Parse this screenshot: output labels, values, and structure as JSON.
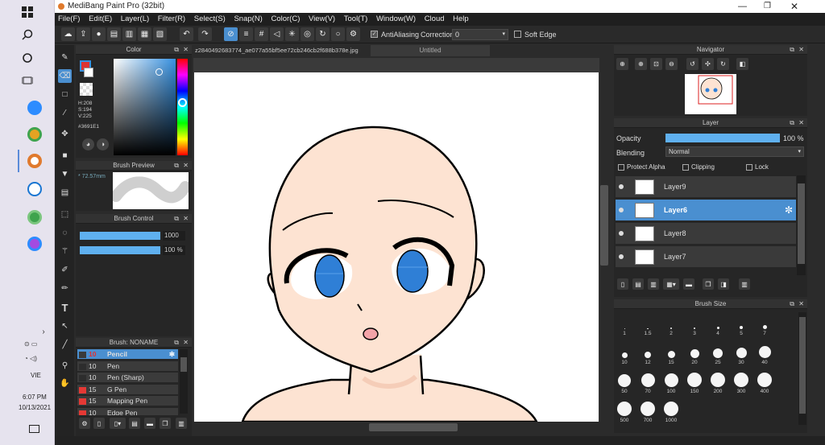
{
  "window": {
    "title": "MediBang Paint Pro (32bit)"
  },
  "menu": [
    "File(F)",
    "Edit(E)",
    "Layer(L)",
    "Filter(R)",
    "Select(S)",
    "Snap(N)",
    "Color(C)",
    "View(V)",
    "Tool(T)",
    "Window(W)",
    "Cloud",
    "Help"
  ],
  "toolbar": {
    "antialias_label": "AntiAliasing",
    "correction_label": "Correction",
    "correction_value": "0",
    "soft_edge_label": "Soft Edge"
  },
  "color_panel": {
    "title": "Color",
    "h": "H:208",
    "s": "S:194",
    "v": "V:225",
    "hex": "#3691E1",
    "main_color": "#3691E1"
  },
  "brush_preview": {
    "title": "Brush Preview",
    "size": "72.57mm"
  },
  "brush_control": {
    "title": "Brush Control",
    "size_value": "1000",
    "opacity_value": "100 %",
    "size_fill": 1.0,
    "opacity_fill": 1.0
  },
  "brush_list": {
    "title": "Brush: NONAME",
    "items": [
      {
        "size": "10",
        "name": "Pencil",
        "color": "#3a3a3a",
        "selected": true
      },
      {
        "size": "10",
        "name": "Pen",
        "color": "#2d2d2d",
        "selected": false
      },
      {
        "size": "10",
        "name": "Pen (Sharp)",
        "color": "#2d2d2d",
        "selected": false
      },
      {
        "size": "15",
        "name": "G Pen",
        "color": "#e53935",
        "selected": false
      },
      {
        "size": "15",
        "name": "Mapping Pen",
        "color": "#e53935",
        "selected": false
      },
      {
        "size": "10",
        "name": "Edge Pen",
        "color": "#e53935",
        "selected": false
      }
    ]
  },
  "tabs": [
    {
      "label": "z2840492683774_ae077a55bf5ee72cb246cb2f688b378e.jpg",
      "active": true
    },
    {
      "label": "Untitled",
      "active": false
    }
  ],
  "navigator": {
    "title": "Navigator"
  },
  "layer_panel": {
    "title": "Layer",
    "opacity_label": "Opacity",
    "opacity_value": "100 %",
    "blending_label": "Blending",
    "blending_value": "Normal",
    "protect_alpha": "Protect Alpha",
    "clipping": "Clipping",
    "lock": "Lock",
    "layers": [
      {
        "name": "Layer9",
        "active": false
      },
      {
        "name": "Layer6",
        "active": true
      },
      {
        "name": "Layer8",
        "active": false
      },
      {
        "name": "Layer7",
        "active": false
      }
    ]
  },
  "brush_size": {
    "title": "Brush Size",
    "rows": [
      [
        "1",
        "1.5",
        "2",
        "3",
        "4",
        "5",
        "7"
      ],
      [
        "10",
        "12",
        "15",
        "20",
        "25",
        "30",
        "40"
      ],
      [
        "50",
        "70",
        "100",
        "150",
        "200",
        "300",
        "400"
      ],
      [
        "500",
        "700",
        "1000"
      ]
    ]
  },
  "clock": {
    "lang": "VIE",
    "time": "6:07 PM",
    "date": "10/13/2021"
  },
  "colors": {
    "accent": "#4a90d9",
    "skin": "#fde3d2",
    "eye": "#2f7fd6",
    "layer_active": "#4a8fd0"
  }
}
